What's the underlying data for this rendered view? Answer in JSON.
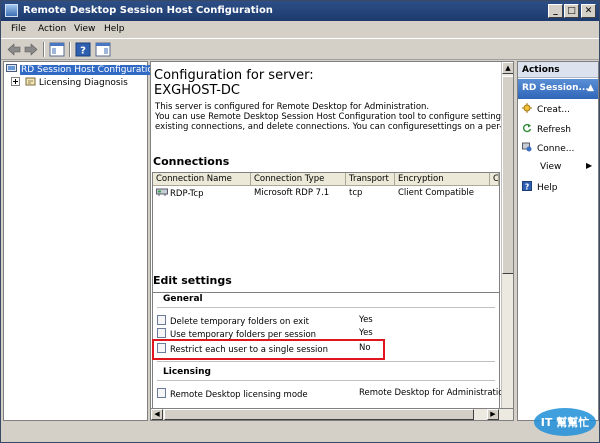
{
  "window": {
    "title": "Remote Desktop Session Host Configuration",
    "controls": {
      "minimize": "_",
      "maximize": "□",
      "close": "✕"
    }
  },
  "menu": {
    "file": "File",
    "action": "Action",
    "view": "View",
    "help": "Help"
  },
  "toolbar": {
    "icons": [
      "back-arrow-icon",
      "forward-arrow-icon",
      "show-hide-tree-icon",
      "help-icon",
      "properties-icon"
    ]
  },
  "tree": {
    "root": "RD Session Host Configuration",
    "child": "Licensing Diagnosis"
  },
  "main": {
    "heading": "Configuration for server:",
    "server": "EXGHOST-DC",
    "description_line1": "This server is configured for Remote Desktop for Administration.",
    "description_line2": "You can use Remote Desktop Session Host Configuration tool to configure settings for new",
    "description_line3": "existing connections, and delete connections. You can configuresettings on a per-connectio",
    "connections": {
      "title": "Connections",
      "columns": [
        "Connection Name",
        "Connection Type",
        "Transport",
        "Encryption",
        "C"
      ],
      "rows": [
        {
          "name": "RDP-Tcp",
          "type": "Microsoft RDP 7.1",
          "transport": "tcp",
          "encryption": "Client Compatible"
        }
      ]
    },
    "edit_settings": {
      "title": "Edit settings",
      "general": {
        "title": "General",
        "items": [
          {
            "label": "Delete temporary folders on exit",
            "value": "Yes"
          },
          {
            "label": "Use temporary folders per session",
            "value": "Yes"
          },
          {
            "label": "Restrict each user to a single session",
            "value": "No"
          }
        ]
      },
      "licensing": {
        "title": "Licensing",
        "items": [
          {
            "label": "Remote Desktop licensing mode",
            "value": "Remote Desktop for Administration"
          }
        ]
      }
    }
  },
  "actions": {
    "header": "Actions",
    "group": "RD Session...",
    "items": [
      {
        "label": "Creat...",
        "icon": "create-connection-icon"
      },
      {
        "label": "Refresh",
        "icon": "refresh-icon"
      },
      {
        "label": "Conne...",
        "icon": "connection-settings-icon"
      },
      {
        "label": "View",
        "icon": "view-submenu-arrow-icon"
      },
      {
        "label": "Help",
        "icon": "help-icon"
      }
    ]
  },
  "watermark": {
    "text": "IT 幫幫忙"
  },
  "colors": {
    "highlight": "#e0161e",
    "selection": "#316ac5",
    "titlebar": "#2d4f86"
  }
}
